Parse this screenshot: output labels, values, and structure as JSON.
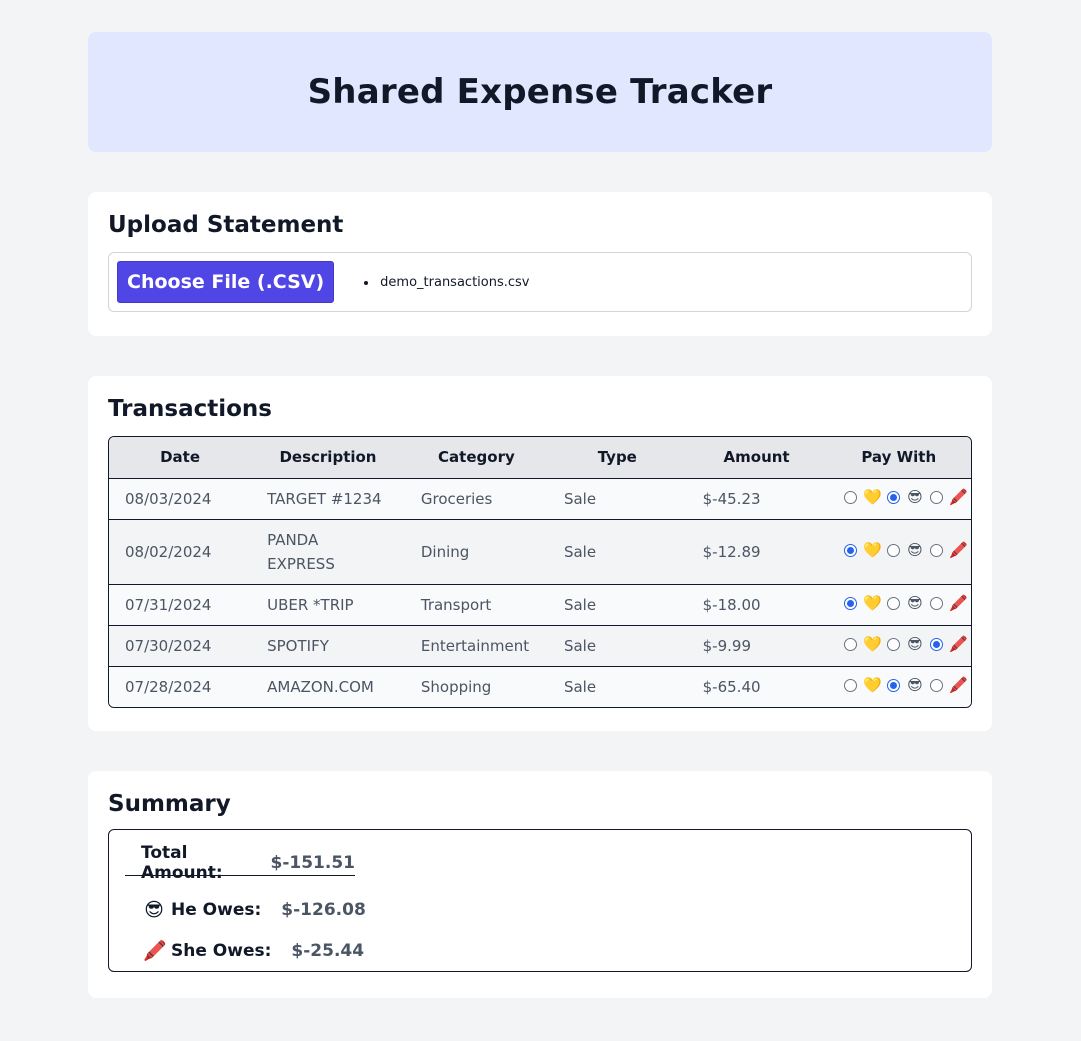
{
  "header": {
    "title": "Shared Expense Tracker"
  },
  "upload": {
    "title": "Upload Statement",
    "button_label": "Choose File (.CSV)",
    "files": [
      "demo_transactions.csv"
    ]
  },
  "transactions": {
    "title": "Transactions",
    "columns": [
      "Date",
      "Description",
      "Category",
      "Type",
      "Amount",
      "Pay With"
    ],
    "pay_options": [
      "shared-heart",
      "he-sunglasses",
      "she-pencil"
    ],
    "rows": [
      {
        "date": "08/03/2024",
        "description": "TARGET #1234",
        "category": "Groceries",
        "type": "Sale",
        "amount": "$-45.23",
        "selected": 1
      },
      {
        "date": "08/02/2024",
        "description": "PANDA EXPRESS",
        "category": "Dining",
        "type": "Sale",
        "amount": "$-12.89",
        "selected": 0
      },
      {
        "date": "07/31/2024",
        "description": "UBER *TRIP",
        "category": "Transport",
        "type": "Sale",
        "amount": "$-18.00",
        "selected": 0
      },
      {
        "date": "07/30/2024",
        "description": "SPOTIFY",
        "category": "Entertainment",
        "type": "Sale",
        "amount": "$-9.99",
        "selected": 2
      },
      {
        "date": "07/28/2024",
        "description": "AMAZON.COM",
        "category": "Shopping",
        "type": "Sale",
        "amount": "$-65.40",
        "selected": 1
      }
    ]
  },
  "summary": {
    "title": "Summary",
    "total_label": "Total Amount:",
    "total_value": "$-151.51",
    "he_label": "He Owes:",
    "he_value": "$-126.08",
    "she_label": "She Owes:",
    "she_value": "$-25.44"
  },
  "colors": {
    "accent": "#4f46e5",
    "header_bg": "#e0e7ff",
    "page_bg": "#f3f4f6",
    "radio_selected": "#2563eb"
  }
}
